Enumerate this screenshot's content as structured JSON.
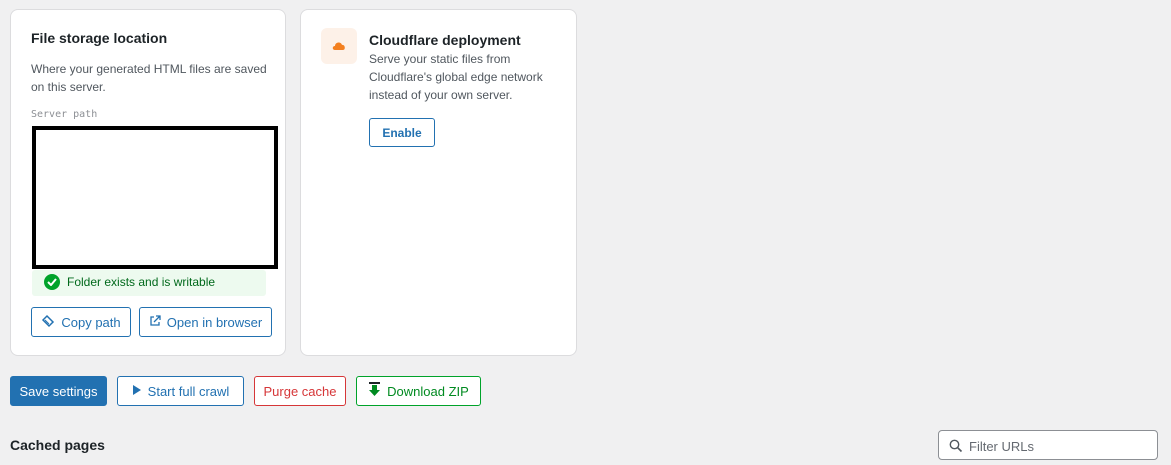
{
  "storage_card": {
    "title": "File storage location",
    "description": "Where your generated HTML files are saved on this server.",
    "server_path_label": "Server path",
    "status_text": "Folder exists and is writable",
    "copy_path_label": "Copy path",
    "open_browser_label": "Open in browser"
  },
  "cloudflare_card": {
    "title": "Cloudflare deployment",
    "description": "Serve your static files from Cloudflare's global edge network instead of your own server.",
    "enable_label": "Enable",
    "icon": "cloud-icon"
  },
  "actions": {
    "save_label": "Save settings",
    "crawl_label": "Start full crawl",
    "purge_label": "Purge cache",
    "zip_label": "Download ZIP"
  },
  "cached_pages": {
    "title": "Cached pages",
    "filter_placeholder": "Filter URLs"
  },
  "colors": {
    "primary": "#2271b1",
    "danger": "#d63638",
    "success": "#00a32a",
    "cloudflare": "#f38020"
  }
}
